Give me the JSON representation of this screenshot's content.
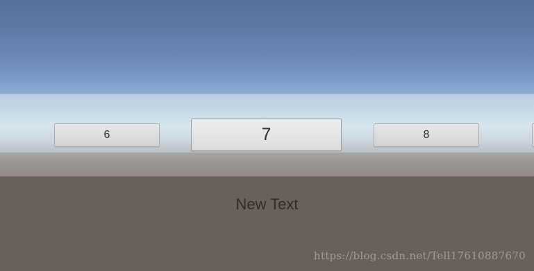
{
  "scroll_items": {
    "left": {
      "label": "6"
    },
    "center": {
      "label": "7"
    },
    "right": {
      "label": "8"
    }
  },
  "caption": {
    "text": "New Text"
  },
  "watermark": {
    "text": "https://blog.csdn.net/Tell17610887670"
  },
  "colors": {
    "sky_top": "#5a7299",
    "sky_bottom": "#8fb0d7",
    "horizon": "#d6e4ee",
    "ground": "#6a605a",
    "item_bg": "#dadcdd",
    "text": "#2e2e2e"
  }
}
